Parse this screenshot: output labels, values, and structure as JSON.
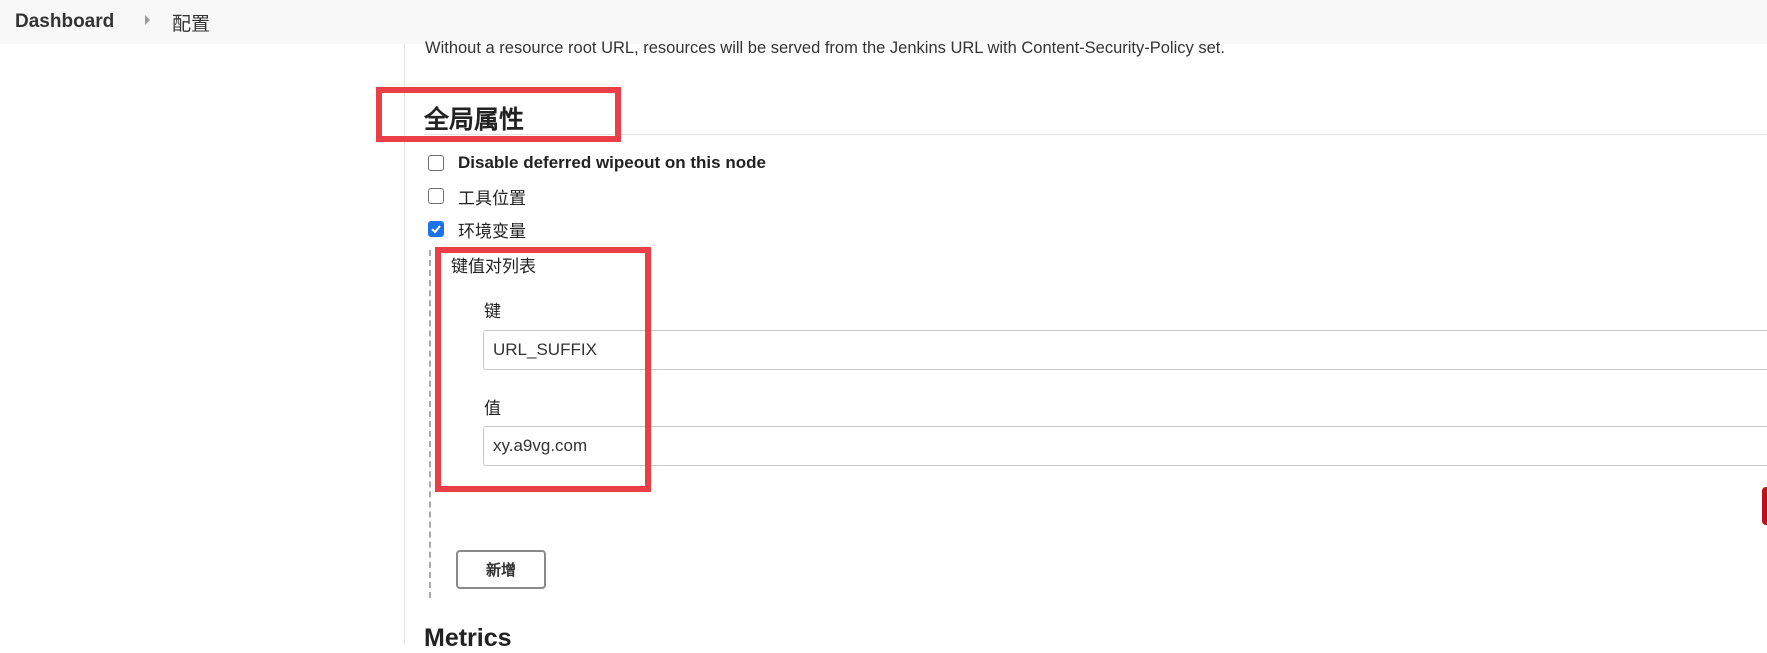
{
  "breadcrumb": {
    "items": [
      {
        "label": "Dashboard"
      },
      {
        "label": "配置"
      }
    ],
    "separator_icon": "chevron-right-icon"
  },
  "resource_root_note": "Without a resource root URL, resources will be served from the Jenkins URL with Content-Security-Policy set.",
  "global_properties": {
    "title": "全局属性",
    "options": [
      {
        "label": "Disable deferred wipeout on this node",
        "checked": false
      },
      {
        "label": "工具位置",
        "checked": false
      },
      {
        "label": "环境变量",
        "checked": true
      }
    ],
    "kv_list": {
      "title": "键值对列表",
      "key_label": "键",
      "key_value": "URL_SUFFIX",
      "value_label": "值",
      "value_value": "xy.a9vg.com",
      "add_button_label": "新增"
    }
  },
  "next_section_title": "Metrics",
  "colors": {
    "highlight": "#ea3f47",
    "checkbox_checked": "#1a73e8",
    "delete_edge": "#b8141c"
  }
}
